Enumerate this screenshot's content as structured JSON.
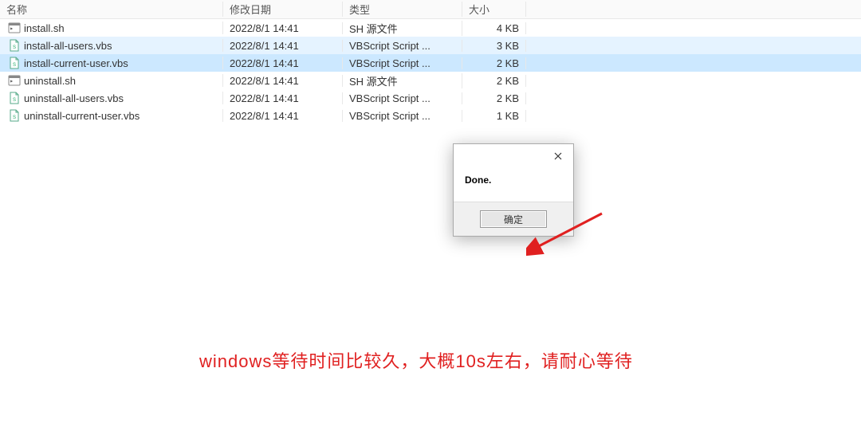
{
  "headers": {
    "name": "名称",
    "date": "修改日期",
    "type": "类型",
    "size": "大小"
  },
  "files": [
    {
      "icon": "sh",
      "name": "install.sh",
      "date": "2022/8/1 14:41",
      "type": "SH 源文件",
      "size": "4 KB",
      "state": ""
    },
    {
      "icon": "vbs",
      "name": "install-all-users.vbs",
      "date": "2022/8/1 14:41",
      "type": "VBScript Script ...",
      "size": "3 KB",
      "state": "hover"
    },
    {
      "icon": "vbs",
      "name": "install-current-user.vbs",
      "date": "2022/8/1 14:41",
      "type": "VBScript Script ...",
      "size": "2 KB",
      "state": "selected"
    },
    {
      "icon": "sh",
      "name": "uninstall.sh",
      "date": "2022/8/1 14:41",
      "type": "SH 源文件",
      "size": "2 KB",
      "state": ""
    },
    {
      "icon": "vbs",
      "name": "uninstall-all-users.vbs",
      "date": "2022/8/1 14:41",
      "type": "VBScript Script ...",
      "size": "2 KB",
      "state": ""
    },
    {
      "icon": "vbs",
      "name": "uninstall-current-user.vbs",
      "date": "2022/8/1 14:41",
      "type": "VBScript Script ...",
      "size": "1 KB",
      "state": ""
    }
  ],
  "dialog": {
    "message": "Done.",
    "ok_label": "确定"
  },
  "caption": "windows等待时间比较久，大概10s左右，请耐心等待"
}
